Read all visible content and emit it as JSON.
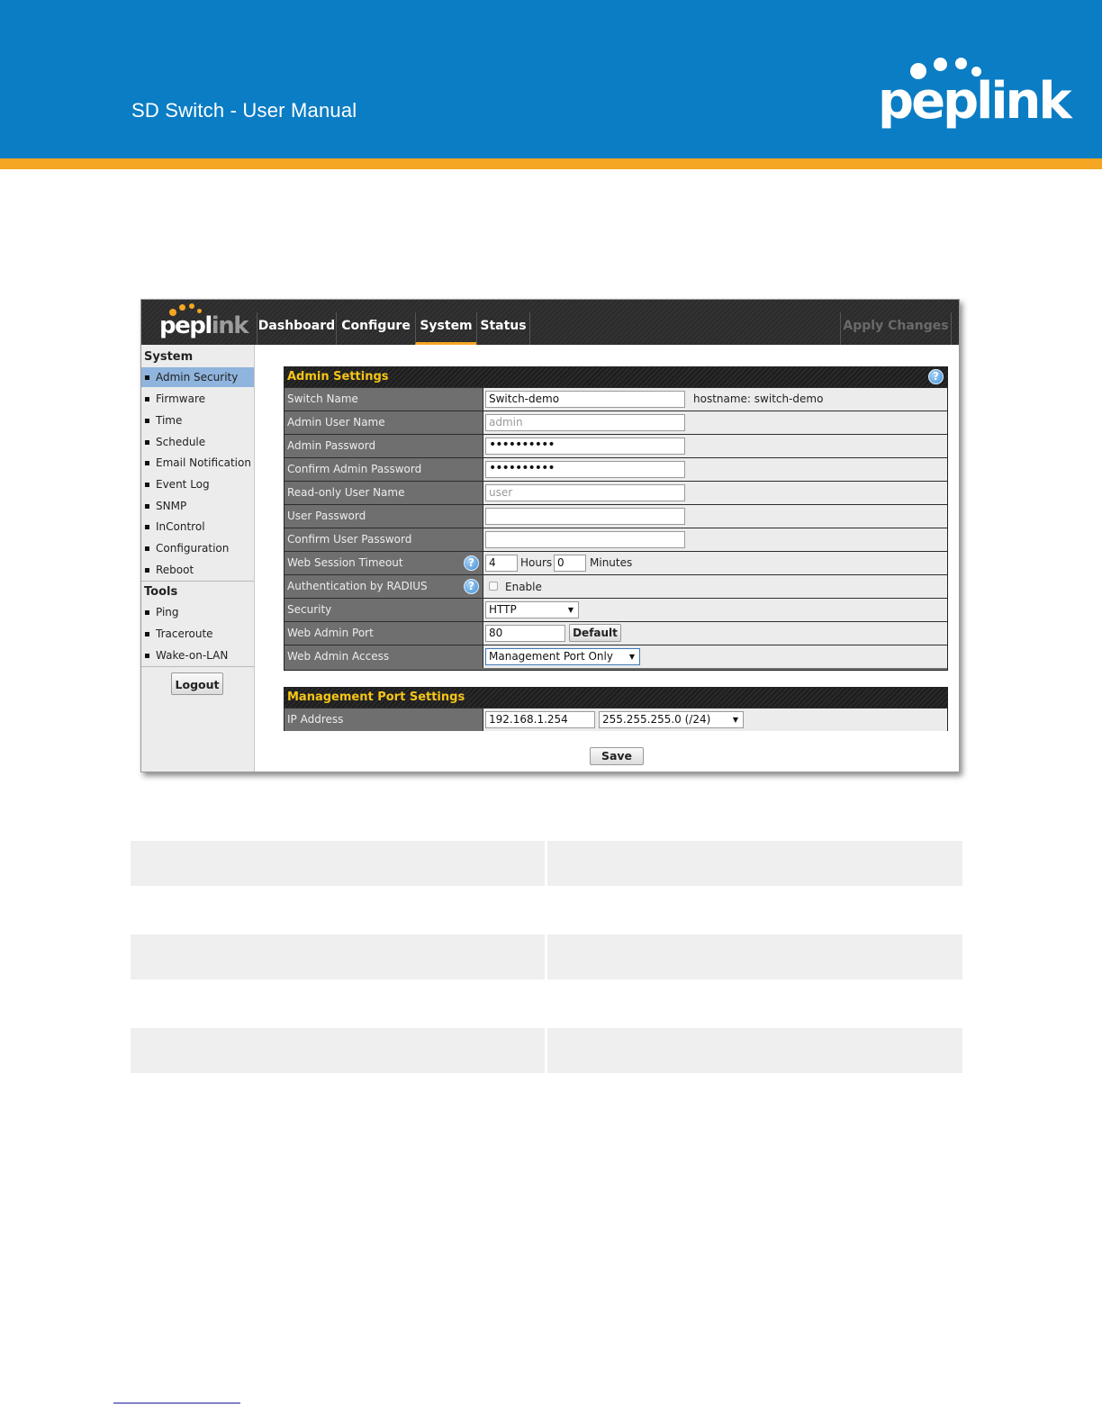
{
  "document": {
    "title": "SD Switch  - User Manual",
    "brand": "peplink"
  },
  "app": {
    "logo": {
      "pep": "pep",
      "link_l": "l",
      "link_ink": "ink"
    },
    "nav_tabs": [
      "Dashboard",
      "Configure",
      "System",
      "Status"
    ],
    "active_tab": "System",
    "apply_changes": "Apply Changes",
    "sidebar": {
      "system_heading": "System",
      "system_items": [
        "Admin Security",
        "Firmware",
        "Time",
        "Schedule",
        "Email Notification",
        "Event Log",
        "SNMP",
        "InControl",
        "Configuration",
        "Reboot"
      ],
      "active_item": "Admin Security",
      "tools_heading": "Tools",
      "tools_items": [
        "Ping",
        "Traceroute",
        "Wake-on-LAN"
      ],
      "logout": "Logout"
    },
    "admin_settings": {
      "title": "Admin Settings",
      "help": "?",
      "switch_name": {
        "label": "Switch Name",
        "value": "Switch-demo",
        "hint": "hostname: switch-demo"
      },
      "admin_user_name": {
        "label": "Admin User Name",
        "value": "admin"
      },
      "admin_password": {
        "label": "Admin Password",
        "value": "••••••••••"
      },
      "confirm_admin_password": {
        "label": "Confirm Admin Password",
        "value": "••••••••••"
      },
      "readonly_user_name": {
        "label": "Read-only User Name",
        "value": "user"
      },
      "user_password": {
        "label": "User Password",
        "value": ""
      },
      "confirm_user_password": {
        "label": "Confirm User Password",
        "value": ""
      },
      "web_session_timeout": {
        "label": "Web Session Timeout",
        "hours": "4",
        "hours_label": "Hours",
        "minutes": "0",
        "minutes_label": "Minutes"
      },
      "auth_radius": {
        "label": "Authentication by RADIUS",
        "checkbox_label": "Enable",
        "checked": false
      },
      "security": {
        "label": "Security",
        "value": "HTTP"
      },
      "web_admin_port": {
        "label": "Web Admin Port",
        "value": "80",
        "button": "Default"
      },
      "web_admin_access": {
        "label": "Web Admin Access",
        "value": "Management Port Only"
      }
    },
    "management_port": {
      "title": "Management Port Settings",
      "ip_address": {
        "label": "IP Address",
        "value": "192.168.1.254",
        "mask": "255.255.255.0 (/24)"
      }
    },
    "save": "Save"
  }
}
